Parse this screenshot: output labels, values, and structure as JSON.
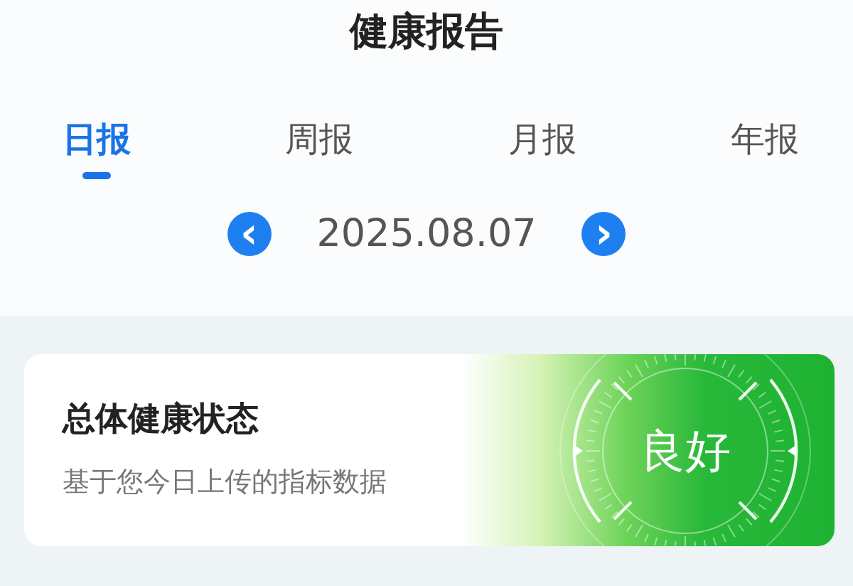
{
  "header": {
    "title": "健康报告"
  },
  "tabs": [
    {
      "label": "日报",
      "selected": true
    },
    {
      "label": "周报",
      "selected": false
    },
    {
      "label": "月报",
      "selected": false
    },
    {
      "label": "年报",
      "selected": false
    }
  ],
  "date_nav": {
    "prev": "‹",
    "date": "2025.08.07",
    "next": "›"
  },
  "status_card": {
    "title": "总体健康状态",
    "subtitle": "基于您今日上传的指标数据",
    "status": "良好"
  }
}
